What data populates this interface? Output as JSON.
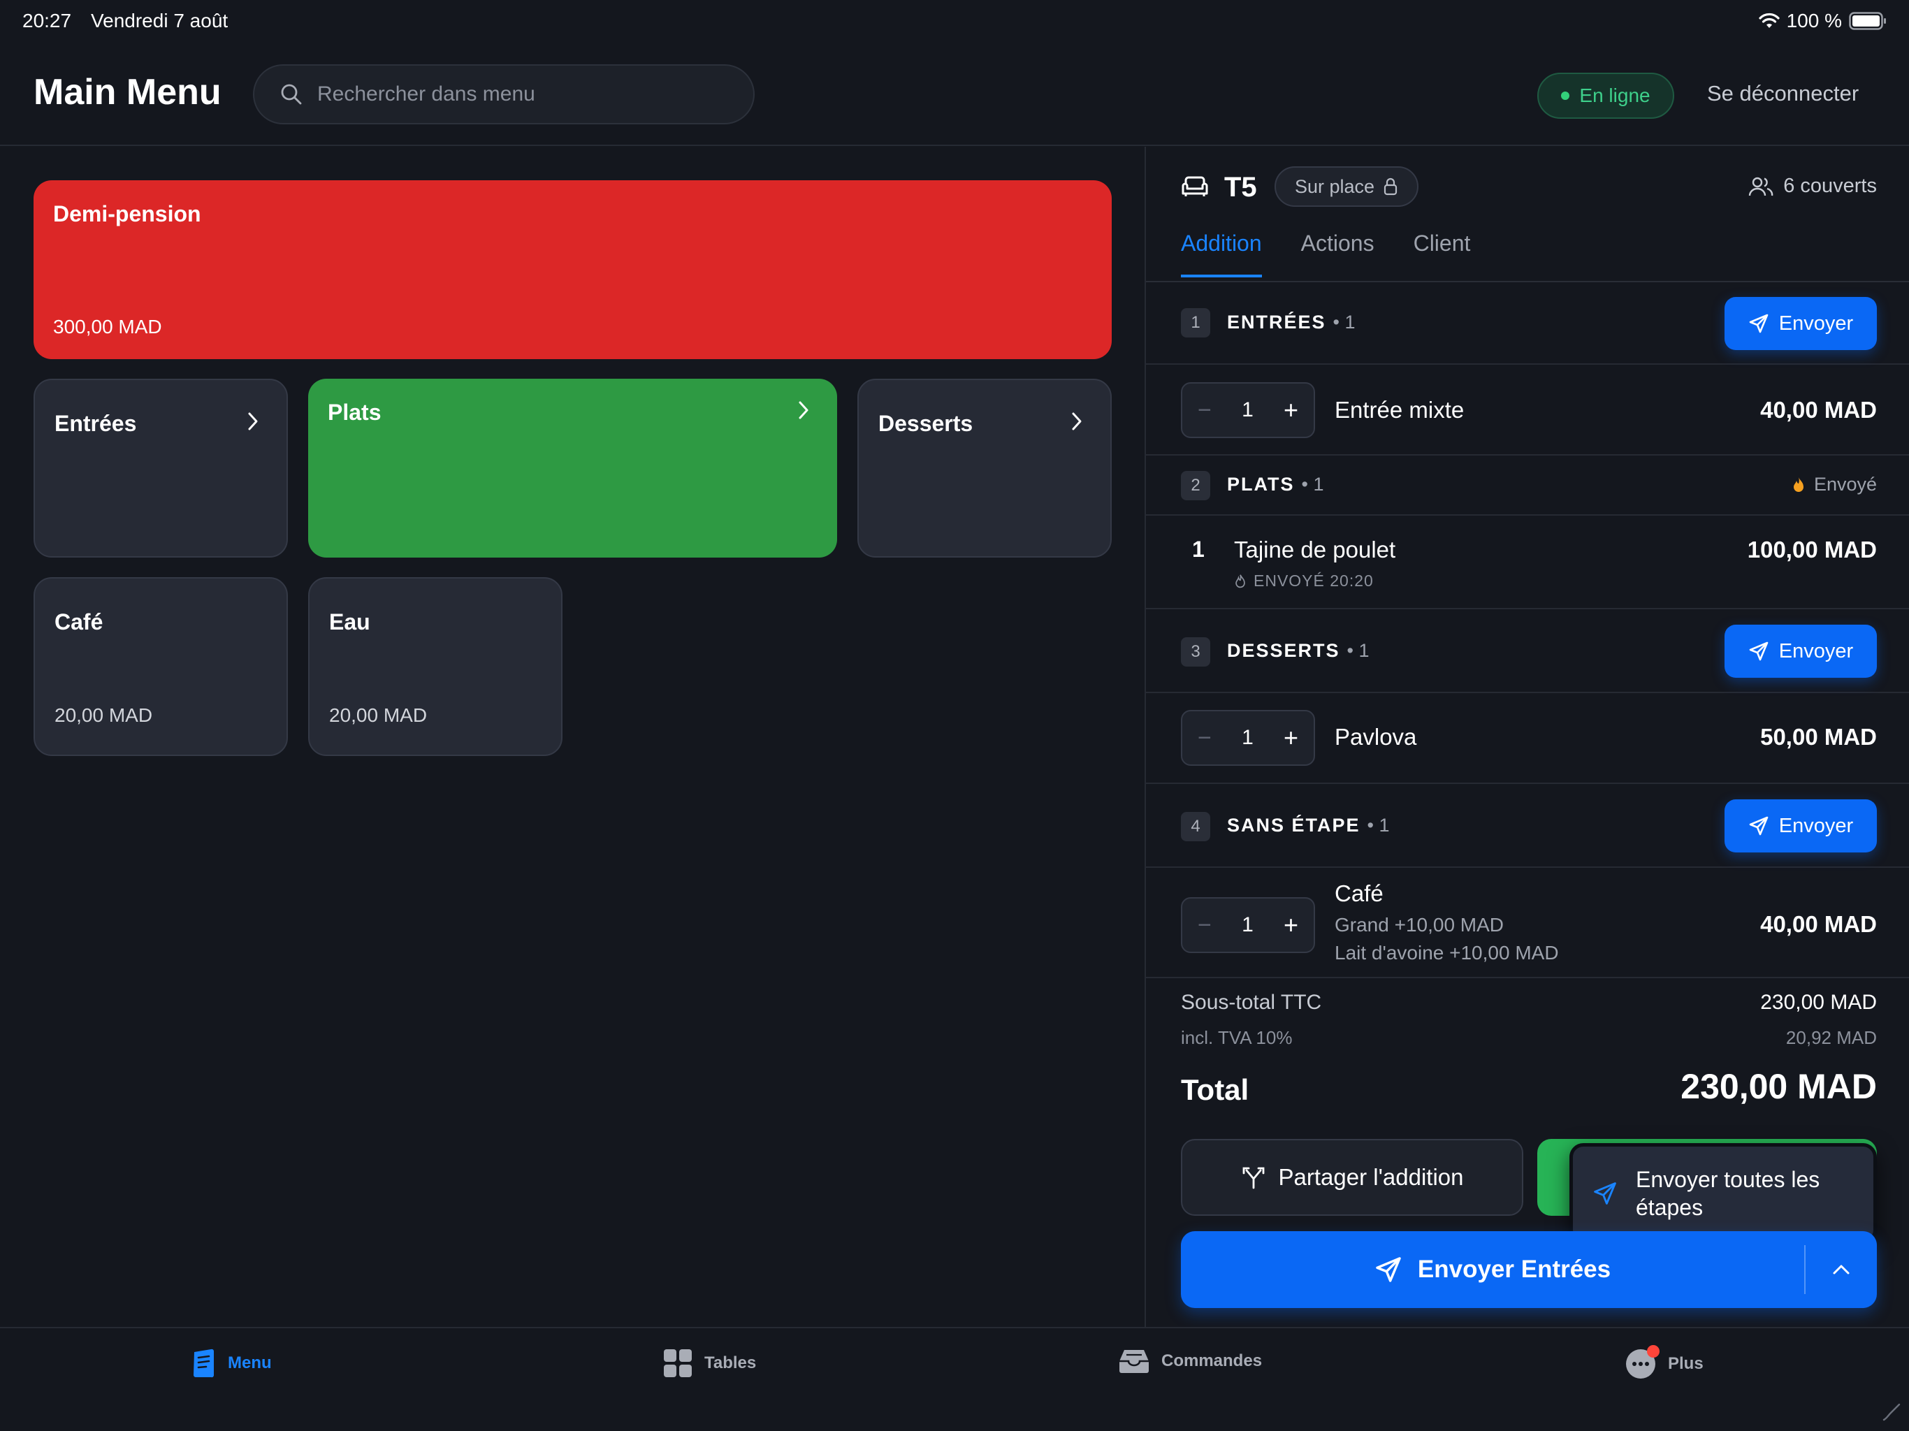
{
  "status_bar": {
    "time": "20:27",
    "date": "Vendredi 7 août",
    "battery": "100 %"
  },
  "header": {
    "title": "Main Menu",
    "search_placeholder": "Rechercher dans menu",
    "online_label": "En ligne",
    "logout_label": "Se déconnecter"
  },
  "menu": {
    "tiles": [
      {
        "name": "Demi-pension",
        "price": "300,00 MAD",
        "color": "#dc2727"
      },
      {
        "name": "Entrées"
      },
      {
        "name": "Plats",
        "color": "#2e9a43"
      },
      {
        "name": "Desserts"
      },
      {
        "name": "Café",
        "price": "20,00 MAD"
      },
      {
        "name": "Eau",
        "price": "20,00 MAD"
      }
    ]
  },
  "order": {
    "table": "T5",
    "service_mode": "Sur place",
    "covers": "6 couverts",
    "tabs": [
      "Addition",
      "Actions",
      "Client"
    ],
    "sections": [
      {
        "num": "1",
        "label": "ENTRÉES",
        "count": "• 1",
        "send_label": "Envoyer",
        "items": [
          {
            "qty": "1",
            "name": "Entrée mixte",
            "price": "40,00 MAD"
          }
        ]
      },
      {
        "num": "2",
        "label": "PLATS",
        "count": "• 1",
        "status": "Envoyé",
        "items": [
          {
            "qty": "1",
            "name": "Tajine de poulet",
            "price": "100,00 MAD",
            "sent": "ENVOYÉ 20:20"
          }
        ]
      },
      {
        "num": "3",
        "label": "DESSERTS",
        "count": "• 1",
        "send_label": "Envoyer",
        "items": [
          {
            "qty": "1",
            "name": "Pavlova",
            "price": "50,00 MAD"
          }
        ]
      },
      {
        "num": "4",
        "label": "SANS ÉTAPE",
        "count": "• 1",
        "send_label": "Envoyer",
        "items": [
          {
            "qty": "1",
            "name": "Café",
            "price": "40,00 MAD",
            "modifiers": [
              "Grand +10,00 MAD",
              "Lait d'avoine +10,00 MAD"
            ]
          }
        ]
      }
    ],
    "subtotal_label": "Sous-total TTC",
    "subtotal_value": "230,00 MAD",
    "tva_label": "incl. TVA 10%",
    "tva_value": "20,92 MAD",
    "total_label": "Total",
    "total_value": "230,00 MAD",
    "split_label": "Partager l'addition",
    "send_all_label": "Envoyer toutes les étapes",
    "send_stage_label": "Envoyer Entrées",
    "accent_color": "#0a68f5"
  },
  "bottom_nav": {
    "items": [
      {
        "label": "Menu",
        "icon": "menu-book-icon"
      },
      {
        "label": "Tables",
        "icon": "grid-icon"
      },
      {
        "label": "Commandes",
        "icon": "tray-icon"
      },
      {
        "label": "Plus",
        "icon": "more-icon"
      }
    ]
  }
}
